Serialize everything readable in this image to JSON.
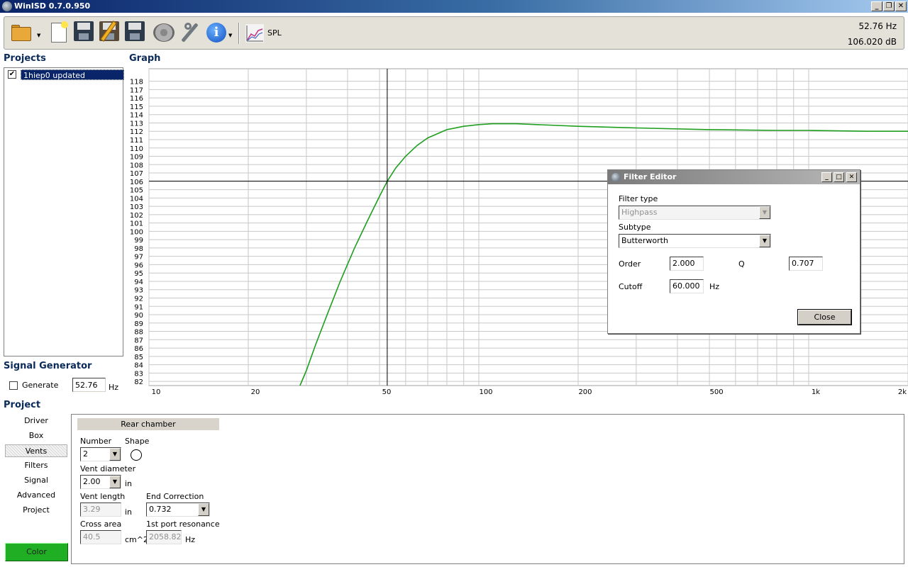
{
  "window": {
    "title": "WinISD 0.7.0.950"
  },
  "toolbar": {
    "spl_label": "SPL",
    "freq_readout": "52.76 Hz",
    "db_readout": "106.020 dB"
  },
  "projects": {
    "title": "Projects",
    "items": [
      {
        "label": "1hiep0 updated",
        "checked": true
      }
    ]
  },
  "graph": {
    "title": "Graph",
    "y_ticks": [
      "82",
      "83",
      "84",
      "85",
      "86",
      "87",
      "88",
      "89",
      "90",
      "91",
      "92",
      "93",
      "94",
      "95",
      "96",
      "97",
      "98",
      "99",
      "100",
      "101",
      "102",
      "103",
      "104",
      "105",
      "106",
      "107",
      "108",
      "109",
      "110",
      "111",
      "112",
      "113",
      "114",
      "115",
      "116",
      "117",
      "118"
    ],
    "x_tick_labels": [
      "10",
      "20",
      "50",
      "100",
      "200",
      "500",
      "1k",
      "2k"
    ],
    "cursor": {
      "freq_hz": 52.76,
      "db": 106.02
    }
  },
  "chart_data": {
    "type": "line",
    "x_scale": "log",
    "xlim": [
      10,
      2000
    ],
    "ylim": [
      81.5,
      119.5
    ],
    "grid": true,
    "series": [
      {
        "color": "#1e9e1e",
        "x": [
          28.7,
          30,
          32,
          35,
          38,
          42,
          46,
          50,
          52.76,
          56,
          60,
          65,
          70,
          80,
          90,
          100,
          110,
          120,
          130,
          150,
          200,
          300,
          500,
          800,
          1000,
          1500,
          2000
        ],
        "y": [
          81.5,
          83.3,
          86.4,
          90.4,
          94.0,
          98.0,
          101.3,
          104.2,
          106.0,
          107.6,
          109.0,
          110.3,
          111.2,
          112.2,
          112.6,
          112.8,
          112.9,
          112.9,
          112.9,
          112.8,
          112.6,
          112.4,
          112.2,
          112.1,
          112.1,
          112.0,
          112.0
        ]
      }
    ]
  },
  "siggen": {
    "title": "Signal Generator",
    "generate_label": "Generate",
    "value": "52.76",
    "unit": "Hz"
  },
  "project": {
    "title": "Project",
    "nav": [
      "Driver",
      "Box",
      "Vents",
      "Filters",
      "Signal",
      "Advanced",
      "Project"
    ],
    "active_nav": "Vents",
    "color_label": "Color",
    "color_hex": "#1fae24"
  },
  "vents": {
    "header": "Rear chamber",
    "number_label": "Number",
    "number_value": "2",
    "shape_label": "Shape",
    "diameter_label": "Vent diameter",
    "diameter_value": "2.00",
    "diameter_unit": "in",
    "length_label": "Vent length",
    "length_value": "3.29",
    "length_unit": "in",
    "endcorr_label": "End Correction",
    "endcorr_value": "0.732",
    "area_label": "Cross area",
    "area_value": "40.5",
    "area_unit": "cm^2",
    "resonance_label": "1st port resonance",
    "resonance_value": "2058.82",
    "resonance_unit": "Hz"
  },
  "dialog": {
    "title": "Filter Editor",
    "filter_type_label": "Filter type",
    "filter_type_value": "Highpass",
    "subtype_label": "Subtype",
    "subtype_value": "Butterworth",
    "order_label": "Order",
    "order_value": "2.000",
    "q_label": "Q",
    "q_value": "0.707",
    "cutoff_label": "Cutoff",
    "cutoff_value": "60.000",
    "cutoff_unit": "Hz",
    "close_label": "Close"
  }
}
